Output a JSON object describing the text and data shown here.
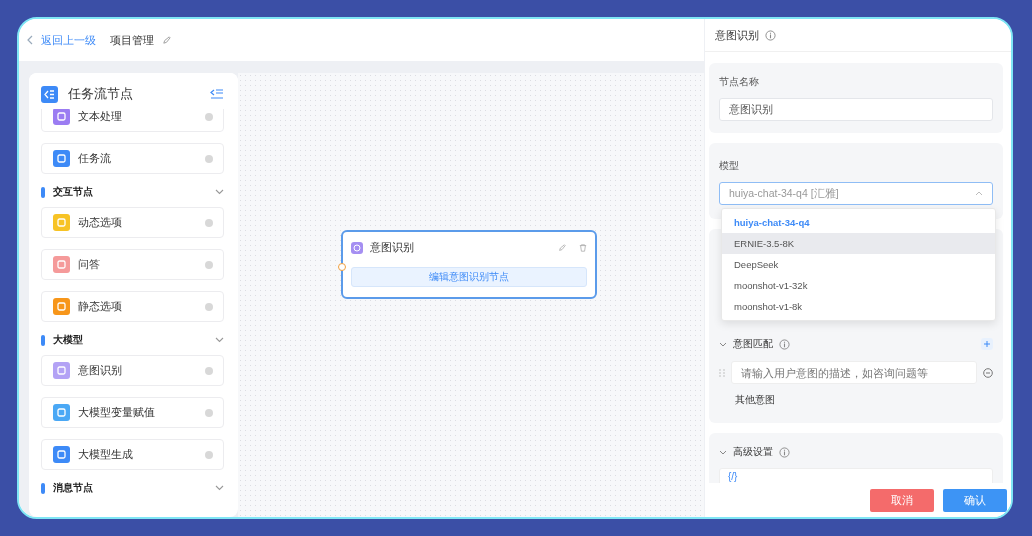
{
  "top_bar": {
    "back_link": "返回上一级",
    "project_title": "项目管理"
  },
  "palette": {
    "title": "任务流节点",
    "entries": [
      {
        "kind": "node",
        "label": "文本处理",
        "color": "#9b7cf2"
      },
      {
        "kind": "node",
        "label": "任务流",
        "color": "#3d8af7"
      },
      {
        "kind": "group",
        "label": "交互节点"
      },
      {
        "kind": "node",
        "label": "动态选项",
        "color": "#f7c325"
      },
      {
        "kind": "node",
        "label": "问答",
        "color": "#f59a9a"
      },
      {
        "kind": "node",
        "label": "静态选项",
        "color": "#f7961a"
      },
      {
        "kind": "group",
        "label": "大模型"
      },
      {
        "kind": "node",
        "label": "意图识别",
        "color": "#b3a2f5"
      },
      {
        "kind": "node",
        "label": "大模型变量赋值",
        "color": "#4aa8f5"
      },
      {
        "kind": "node",
        "label": "大模型生成",
        "color": "#3d8af7"
      },
      {
        "kind": "group",
        "label": "消息节点"
      }
    ]
  },
  "canvas": {
    "node": {
      "title": "意图识别",
      "action": "编辑意图识别节点",
      "selected": true
    }
  },
  "panel": {
    "title": "意图识别",
    "name_field": {
      "label": "节点名称",
      "value": "意图识别"
    },
    "model_field": {
      "label": "模型",
      "value": "huiya-chat-34-q4 [汇雅]",
      "expanded": true,
      "options": [
        {
          "label": "huiya-chat-34-q4",
          "selected": true,
          "hovered": false
        },
        {
          "label": "ERNIE-3.5-8K",
          "selected": false,
          "hovered": true
        },
        {
          "label": "DeepSeek",
          "selected": false,
          "hovered": false
        },
        {
          "label": "moonshot-v1-32k",
          "selected": false,
          "hovered": false
        },
        {
          "label": "moonshot-v1-8k",
          "selected": false,
          "hovered": false
        }
      ]
    },
    "intent_match": {
      "title": "意图匹配",
      "placeholder": "请输入用户意图的描述，如咨询问题等",
      "other_intent": "其他意图"
    },
    "advanced": {
      "title": "高级设置",
      "code": "{/}"
    },
    "buttons": [
      {
        "label": "取消",
        "kind": "cancel"
      },
      {
        "label": "确认",
        "kind": "confirm"
      }
    ]
  }
}
